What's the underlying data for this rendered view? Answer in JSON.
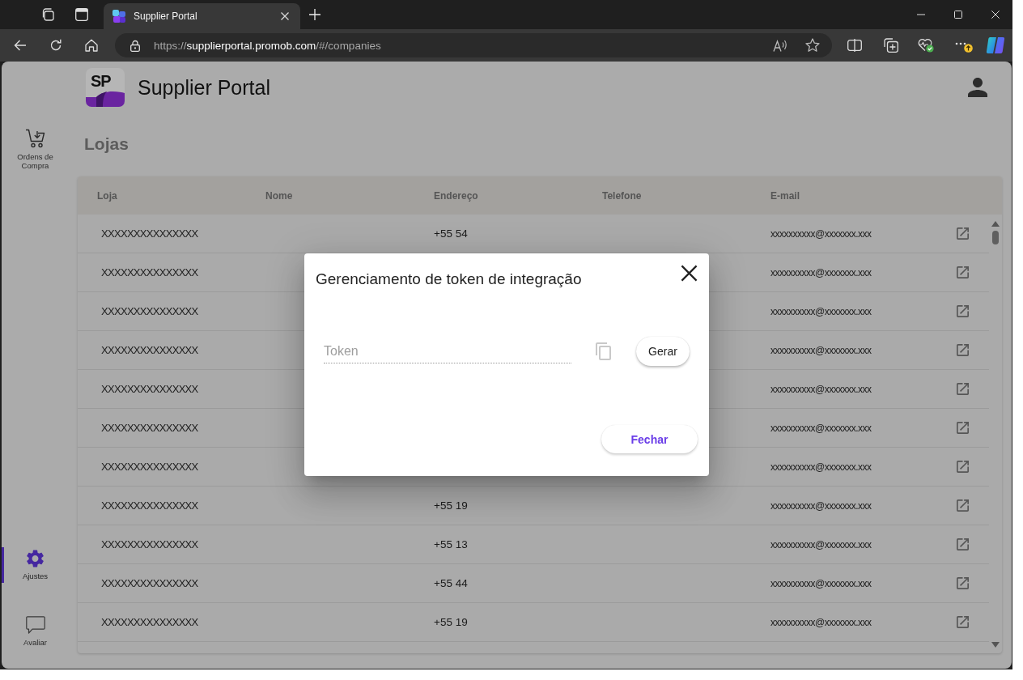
{
  "browser": {
    "tabs": [
      {
        "title": "Supplier Portal",
        "selected": true
      }
    ],
    "address": {
      "scheme": "https://",
      "host": "supplierportal.promob.com",
      "path": "/#/companies"
    }
  },
  "app": {
    "logo_text": "SP",
    "title": "Supplier Portal"
  },
  "sidebar": {
    "items": [
      {
        "label": "Ordens de Compra",
        "selected": false
      },
      {
        "label": "Ajustes",
        "selected": true
      },
      {
        "label": "Avaliar",
        "selected": false
      }
    ]
  },
  "page_title": "Lojas",
  "table": {
    "columns": [
      "Loja",
      "Nome",
      "Endereço",
      "Telefone",
      "E-mail"
    ],
    "rows": [
      {
        "loja": "XXXXXXXXXXXXXXX",
        "endereco": "+55 54",
        "email": "xxxxxxxxxx@xxxxxxx.xxx"
      },
      {
        "loja": "XXXXXXXXXXXXXXX",
        "email": "xxxxxxxxxx@xxxxxxx.xxx"
      },
      {
        "loja": "XXXXXXXXXXXXXXX",
        "email": "xxxxxxxxxx@xxxxxxx.xxx"
      },
      {
        "loja": "XXXXXXXXXXXXXXX",
        "email": "xxxxxxxxxx@xxxxxxx.xxx"
      },
      {
        "loja": "XXXXXXXXXXXXXXX",
        "email": "xxxxxxxxxx@xxxxxxx.xxx"
      },
      {
        "loja": "XXXXXXXXXXXXXXX",
        "email": "xxxxxxxxxx@xxxxxxx.xxx"
      },
      {
        "loja": "XXXXXXXXXXXXXXX",
        "email": "xxxxxxxxxx@xxxxxxx.xxx"
      },
      {
        "loja": "XXXXXXXXXXXXXXX",
        "endereco": "+55 19",
        "email": "xxxxxxxxxx@xxxxxxx.xxx"
      },
      {
        "loja": "XXXXXXXXXXXXXXX",
        "endereco": "+55 13",
        "email": "xxxxxxxxxx@xxxxxxx.xxx"
      },
      {
        "loja": "XXXXXXXXXXXXXXX",
        "endereco": "+55 44",
        "email": "xxxxxxxxxx@xxxxxxx.xxx"
      },
      {
        "loja": "XXXXXXXXXXXXXXX",
        "endereco": "+55 19",
        "email": "xxxxxxxxxx@xxxxxxx.xxx"
      }
    ]
  },
  "dialog": {
    "title": "Gerenciamento de token de integração",
    "token_placeholder": "Token",
    "copy_disabled": true,
    "generate_label": "Gerar",
    "close_label": "Fechar"
  }
}
